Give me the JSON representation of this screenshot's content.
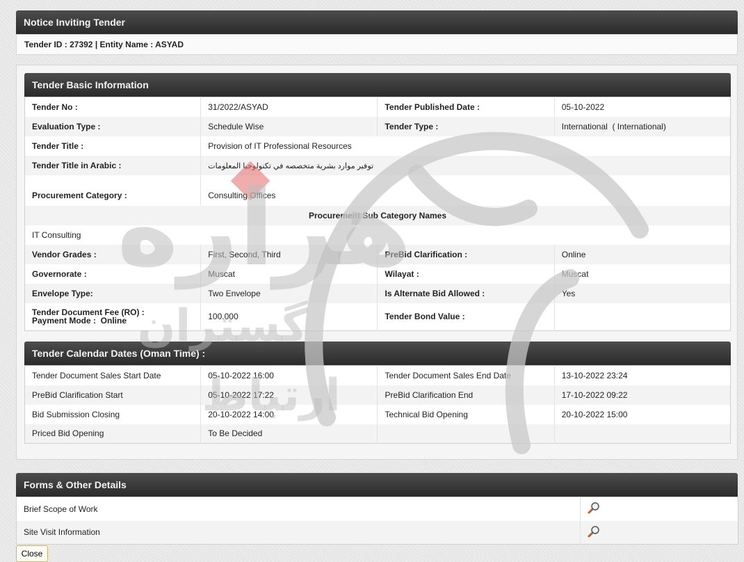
{
  "notice": {
    "title": "Notice Inviting Tender",
    "info": "Tender ID : 27392 | Entity Name : ASYAD"
  },
  "basic": {
    "title": "Tender Basic Information",
    "tender_no_label": "Tender No :",
    "tender_no": "31/2022/ASYAD",
    "published_label": "Tender Published Date :",
    "published": "05-10-2022",
    "eval_type_label": "Evaluation Type :",
    "eval_type": "Schedule Wise",
    "tender_type_label": "Tender Type :",
    "tender_type": "International  ( International)",
    "title_label": "Tender Title :",
    "tender_title": "Provision of IT Professional Resources",
    "title_ar_label": "Tender Title in Arabic :",
    "title_ar": "توفير موارد بشرية متخصصه في تكنولوجيا المعلومات",
    "proc_cat_label": "Procurement Category :",
    "proc_cat": "Consulting Offices",
    "sub_cat_header": "Procurement Sub Category Names",
    "sub_cat": "IT Consulting",
    "vendor_grades_label": "Vendor Grades :",
    "vendor_grades": "First, Second, Third",
    "prebid_label": "PreBid Clarification :",
    "prebid": "Online",
    "governorate_label": "Governorate :",
    "governorate": "Muscat",
    "wilayat_label": "Wilayat :",
    "wilayat": "Muscat",
    "envelope_label": "Envelope Type:",
    "envelope": "Two Envelope",
    "alt_bid_label": "Is Alternate Bid Allowed :",
    "alt_bid": "Yes",
    "doc_fee_label": "Tender Document Fee (RO) :",
    "payment_mode_label": "Payment Mode :  Online",
    "doc_fee": "100.000",
    "bond_label": "Tender Bond Value :",
    "bond": ""
  },
  "calendar": {
    "title": "Tender Calendar Dates (Oman Time) :",
    "rows": [
      {
        "l1": "Tender Document Sales Start Date",
        "v1": "05-10-2022 16:00",
        "l2": "Tender Document Sales End Date",
        "v2": "13-10-2022 23:24"
      },
      {
        "l1": "PreBid Clarification Start",
        "v1": "05-10-2022 17:22",
        "l2": "PreBid Clarification End",
        "v2": "17-10-2022 09:22"
      },
      {
        "l1": "Bid Submission Closing",
        "v1": "20-10-2022 14:00",
        "l2": "Technical Bid Opening",
        "v2": "20-10-2022 15:00"
      },
      {
        "l1": "Priced Bid Opening",
        "v1": "To Be Decided",
        "l2": "",
        "v2": ""
      }
    ]
  },
  "forms": {
    "title": "Forms & Other Details",
    "items": [
      "Brief Scope of Work",
      "Site Visit Information"
    ],
    "view_icon": "magnifier-icon"
  },
  "close_label": "Close",
  "watermark": {
    "text_main": "هراره",
    "text_sub": "گستران",
    "text_sub2": "ارتباط"
  },
  "colors": {
    "header_bg": "#333333",
    "header_text": "#f2f2f2",
    "row_alt": "#f3f3f3",
    "watermark": "#d9d9d9",
    "watermark_accent": "#e26a6a"
  }
}
